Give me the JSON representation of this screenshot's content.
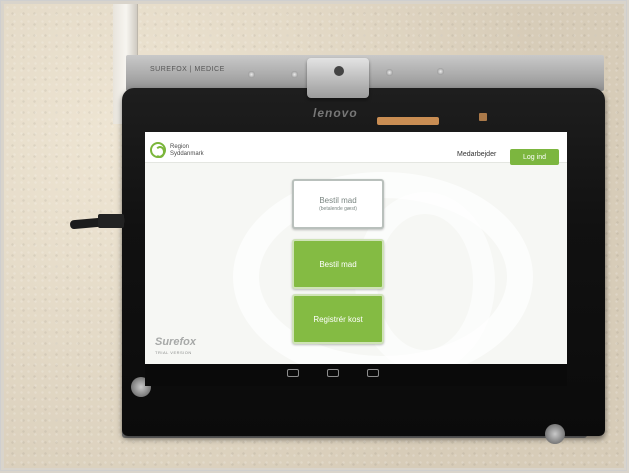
{
  "device": {
    "mount_label": "SUREFOX | MEDICE",
    "brand": "lenovo"
  },
  "app": {
    "organization": {
      "line1": "Region",
      "line2": "Syddanmark"
    },
    "header": {
      "role_label": "Medarbejder",
      "login_button": "Log ind"
    },
    "menu": {
      "paying_guest_order": {
        "label": "Bestil mad",
        "sublabel": "(betalende gæst)"
      },
      "order_food": {
        "label": "Bestil mad"
      },
      "register_diet": {
        "label": "Registrér kost"
      }
    },
    "trial": {
      "brand": "Surefox",
      "note": "TRIAL VERSION"
    }
  },
  "colors": {
    "accent_green": "#7cb63f",
    "button_white": "#ffffff",
    "screen_background": "#f6f7f4"
  }
}
